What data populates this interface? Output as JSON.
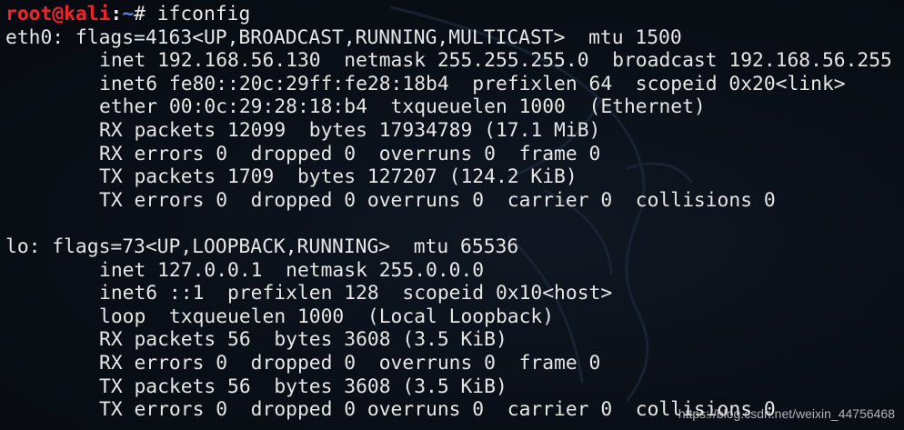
{
  "prompt": {
    "user_host": "root@kali",
    "separator": ":",
    "directory": "~",
    "symbol": "# ",
    "command": "ifconfig"
  },
  "interfaces": [
    {
      "header": "eth0: flags=4163<UP,BROADCAST,RUNNING,MULTICAST>  mtu 1500",
      "lines": [
        "inet 192.168.56.130  netmask 255.255.255.0  broadcast 192.168.56.255",
        "inet6 fe80::20c:29ff:fe28:18b4  prefixlen 64  scopeid 0x20<link>",
        "ether 00:0c:29:28:18:b4  txqueuelen 1000  (Ethernet)",
        "RX packets 12099  bytes 17934789 (17.1 MiB)",
        "RX errors 0  dropped 0  overruns 0  frame 0",
        "TX packets 1709  bytes 127207 (124.2 KiB)",
        "TX errors 0  dropped 0 overruns 0  carrier 0  collisions 0"
      ]
    },
    {
      "header": "lo: flags=73<UP,LOOPBACK,RUNNING>  mtu 65536",
      "lines": [
        "inet 127.0.0.1  netmask 255.0.0.0",
        "inet6 ::1  prefixlen 128  scopeid 0x10<host>",
        "loop  txqueuelen 1000  (Local Loopback)",
        "RX packets 56  bytes 3608 (3.5 KiB)",
        "RX errors 0  dropped 0  overruns 0  frame 0",
        "TX packets 56  bytes 3608 (3.5 KiB)",
        "TX errors 0  dropped 0 overruns 0  carrier 0  collisions 0"
      ]
    }
  ],
  "watermark": "https://blog.csdn.net/weixin_44756468",
  "colors": {
    "background": "#0a0f17",
    "text": "#e6e6e6",
    "prompt_user": "#f0242c",
    "prompt_dir": "#5c87d6"
  },
  "icons": [
    "kali-dragon-watermark"
  ]
}
